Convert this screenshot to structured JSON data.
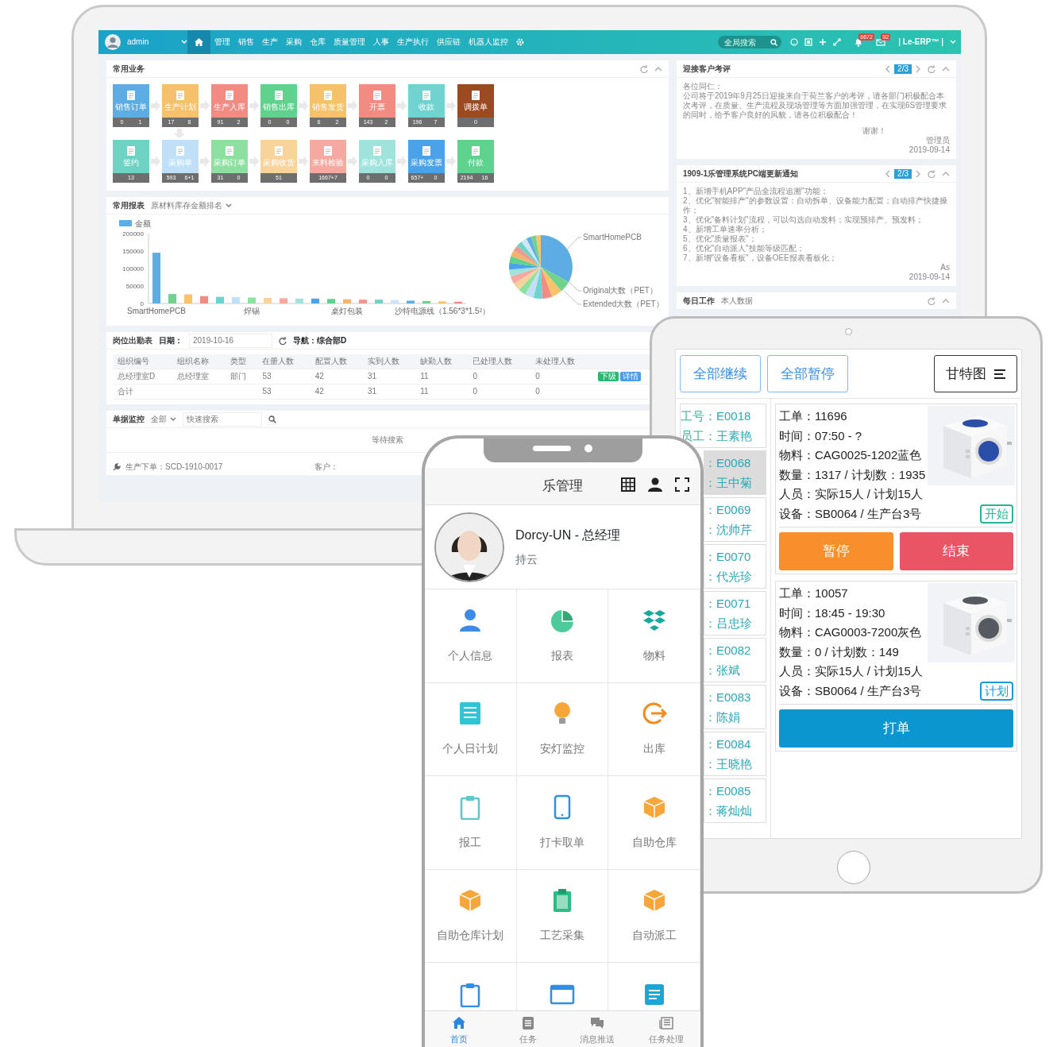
{
  "laptop": {
    "user": {
      "name": "admin"
    },
    "home_selected": true,
    "nav": [
      {
        "label": "管理"
      },
      {
        "label": "销售"
      },
      {
        "label": "生产"
      },
      {
        "label": "采购"
      },
      {
        "label": "仓库"
      },
      {
        "label": "质量管理"
      },
      {
        "label": "人事"
      },
      {
        "label": "生产执行"
      },
      {
        "label": "供应链"
      },
      {
        "label": "机器人监控"
      }
    ],
    "search": {
      "placeholder": "全局搜索"
    },
    "badges": [
      "6672",
      "92"
    ],
    "brand": "| Le-ERP™ |",
    "business": {
      "title": "常用业务",
      "rows": [
        [
          {
            "label": "销售订单",
            "counts": [
              "0",
              "1"
            ],
            "color": "#5dade2"
          },
          {
            "label": "生产计划",
            "counts": [
              "17",
              "8"
            ],
            "color": "#f5c26b"
          },
          {
            "label": "生产入库",
            "counts": [
              "91",
              "2"
            ],
            "color": "#f28b82"
          },
          {
            "label": "销售出库",
            "counts": [
              "0",
              "0"
            ],
            "color": "#5fd38d"
          },
          {
            "label": "销售发货",
            "counts": [
              "6",
              "2"
            ],
            "color": "#f5c26b"
          },
          {
            "label": "开票",
            "counts": [
              "143",
              "2"
            ],
            "color": "#f28b82"
          },
          {
            "label": "收款",
            "counts": [
              "196",
              "7"
            ],
            "color": "#6fd3d0"
          },
          {
            "label": "调拨单",
            "counts": [
              "0"
            ],
            "color": "#9c4a22"
          }
        ],
        [
          {
            "label": "签约",
            "counts": [
              "13"
            ],
            "color": "#6fd3c3"
          },
          {
            "label": "采购单",
            "counts": [
              "593",
              "6+1"
            ],
            "color": "#bfe0f7"
          },
          {
            "label": "采购订单",
            "counts": [
              "31",
              "0"
            ],
            "color": "#8ee0a0"
          },
          {
            "label": "采购收货",
            "counts": [
              "51"
            ],
            "color": "#f8d49a"
          },
          {
            "label": "来料检验",
            "counts": [
              "1667+7"
            ],
            "color": "#f5a9a0"
          },
          {
            "label": "采购入库",
            "counts": [
              "0",
              "0"
            ],
            "color": "#a0e3dc"
          },
          {
            "label": "采购发票",
            "counts": [
              "657+",
              "0"
            ],
            "color": "#4aa3e8"
          },
          {
            "label": "付款",
            "counts": [
              "2194",
              "16"
            ],
            "color": "#5fd38d"
          }
        ]
      ]
    },
    "report": {
      "title": "常用报表",
      "filter": "原材料库存金额排名",
      "chart_data": {
        "type": "bar",
        "categories": [
          "SmartHomePCB",
          null,
          null,
          null,
          null,
          null,
          "焊锡",
          null,
          null,
          null,
          null,
          null,
          "桌灯包装",
          null,
          null,
          null,
          null,
          null,
          "沙特电源线（1.56*3*1.5²）",
          null
        ],
        "ylim": [
          0,
          200000
        ],
        "yticks": [
          0,
          50000,
          100000,
          150000,
          200000
        ],
        "series": [
          {
            "name": "金额",
            "values": [
              145000,
              27000,
              26000,
              21000,
              19000,
              18000,
              17000,
              16000,
              15000,
              14000,
              14000,
              13000,
              12000,
              11000,
              11000,
              10000,
              8000,
              7000,
              6000,
              5000
            ]
          }
        ]
      },
      "pie_labels": [
        "SmartHomePCB",
        "Original大数（PET）",
        "Extended大数（PET）"
      ]
    },
    "attendance": {
      "title": "岗位出勤表",
      "date_label": "日期：",
      "date": "2019-10-16",
      "nav_label": "导航：综合部D",
      "columns": [
        "组织编号",
        "组织名称",
        "类型",
        "在册人数",
        "配置人数",
        "实到人数",
        "缺勤人数",
        "已处理人数",
        "未处理人数"
      ],
      "rows": [
        {
          "cells": [
            "总经理室D",
            "总经理室",
            "部门",
            "53",
            "42",
            "31",
            "11",
            "0",
            "0"
          ],
          "actions": [
            {
              "label": "下级",
              "kind": "success"
            },
            {
              "label": "详情",
              "kind": "info"
            }
          ]
        },
        {
          "cells": [
            "合计",
            null,
            null,
            "53",
            "42",
            "31",
            "11",
            "0",
            "0"
          ]
        }
      ]
    },
    "monitor": {
      "title": "单据监控",
      "filter": "全部",
      "search_placeholder": "快速搜索",
      "empty": "等待搜索",
      "order": "生产下单：SCD-1910-0017",
      "customer": "客户："
    },
    "notices": [
      {
        "title": "迎接客户考评",
        "page": "2/3",
        "lines": [
          "各位同仁：",
          "公司将于2019年9月25日迎接来自于荷兰客户的考评，请各部门积极配合本次考评，在质量、生产流程及现场管理等方面加强管理，在实现6S管理要求的同时，给予客户良好的风貌，请各位积极配合！"
        ],
        "closing": "谢谢！",
        "sign": "管理员",
        "date": "2019-09-14"
      },
      {
        "title": "1909-1乐管理系统PC端更新通知",
        "page": "2/3",
        "lines": [
          "1、新增手机APP\"产品全流程追溯\"功能；",
          "2、优化\"智能排产\"的参数设置：自动拆单、设备能力配置；自动排产快捷操作；",
          "3、优化\"备料计划\"流程，可以勾选自动发料；实现预排产、预发料；",
          "4、新增工单速率分析；",
          "5、优化\"质量报表\"；",
          "6、优化\"自动派人\"技能等级匹配；",
          "7、新增\"设备看板\"，设备OEE报表看板化；"
        ],
        "sign": "As",
        "date": "2019-09-14"
      }
    ],
    "daily": {
      "title": "每日工作",
      "filter": "本人数据"
    }
  },
  "tablet": {
    "toolbar": [
      {
        "label": "全部继续"
      },
      {
        "label": "全部暂停"
      }
    ],
    "gantt": {
      "label": "甘特图"
    },
    "workers": [
      {
        "id_label": "工号：",
        "id": "E0018",
        "name_label": "员工：",
        "name": "王素艳",
        "selected": false
      },
      {
        "id_label": "：",
        "id": "E0068",
        "name_label": "：",
        "name": "王中菊",
        "selected": true
      },
      {
        "id_label": "：",
        "id": "E0069",
        "name_label": "：",
        "name": "沈帅芹",
        "selected": false
      },
      {
        "id_label": "：",
        "id": "E0070",
        "name_label": "：",
        "name": "代光珍",
        "selected": false
      },
      {
        "id_label": "：",
        "id": "E0071",
        "name_label": "：",
        "name": "吕忠珍",
        "selected": false
      },
      {
        "id_label": "：",
        "id": "E0082",
        "name_label": "：",
        "name": "张斌",
        "selected": false
      },
      {
        "id_label": "：",
        "id": "E0083",
        "name_label": "：",
        "name": "陈娟",
        "selected": false
      },
      {
        "id_label": "：",
        "id": "E0084",
        "name_label": "：",
        "name": "王晓艳",
        "selected": false
      },
      {
        "id_label": "：",
        "id": "E0085",
        "name_label": "：",
        "name": "蒋灿灿",
        "selected": false
      }
    ],
    "orders": [
      {
        "fields": [
          {
            "label": "工单：",
            "value": "11696"
          },
          {
            "label": "时间：",
            "value": "07:50 - ?"
          },
          {
            "label": "物料：",
            "value": "CAG0025-1202蓝色"
          },
          {
            "label": "数量：",
            "value": "1317 / 计划数：1935"
          },
          {
            "label": "人员：",
            "value": "实际15人 / 计划15人"
          },
          {
            "label": "设备：",
            "value": "SB0064 / 生产台3号"
          }
        ],
        "status": {
          "label": "开始",
          "kind": "start"
        },
        "actions": [
          {
            "label": "暂停",
            "kind": "pause"
          },
          {
            "label": "结束",
            "kind": "end"
          }
        ]
      },
      {
        "fields": [
          {
            "label": "工单：",
            "value": "10057"
          },
          {
            "label": "时间：",
            "value": "18:45 - 19:30"
          },
          {
            "label": "物料：",
            "value": "CAG0003-7200灰色"
          },
          {
            "label": "数量：",
            "value": "0 / 计划数：149"
          },
          {
            "label": "人员：",
            "value": "实际15人 / 计划15人"
          },
          {
            "label": "设备：",
            "value": "SB0064 / 生产台3号"
          }
        ],
        "status": {
          "label": "计划",
          "kind": "plan"
        },
        "actions": [
          {
            "label": "打单",
            "kind": "print"
          }
        ]
      }
    ]
  },
  "phone": {
    "title": "乐管理",
    "profile": {
      "name": "Dorcy-UN - 总经理",
      "company": "持云"
    },
    "menu": [
      {
        "label": "个人信息"
      },
      {
        "label": "报表"
      },
      {
        "label": "物料"
      },
      {
        "label": "个人日计划"
      },
      {
        "label": "安灯监控"
      },
      {
        "label": "出库"
      },
      {
        "label": "报工"
      },
      {
        "label": "打卡取单"
      },
      {
        "label": "自助仓库"
      },
      {
        "label": "自助仓库计划"
      },
      {
        "label": "工艺采集"
      },
      {
        "label": "自动派工"
      }
    ],
    "tabs": [
      {
        "label": "首页",
        "selected": true
      },
      {
        "label": "任务",
        "selected": false
      },
      {
        "label": "消息推送",
        "selected": false
      },
      {
        "label": "任务处理",
        "selected": false
      }
    ]
  }
}
